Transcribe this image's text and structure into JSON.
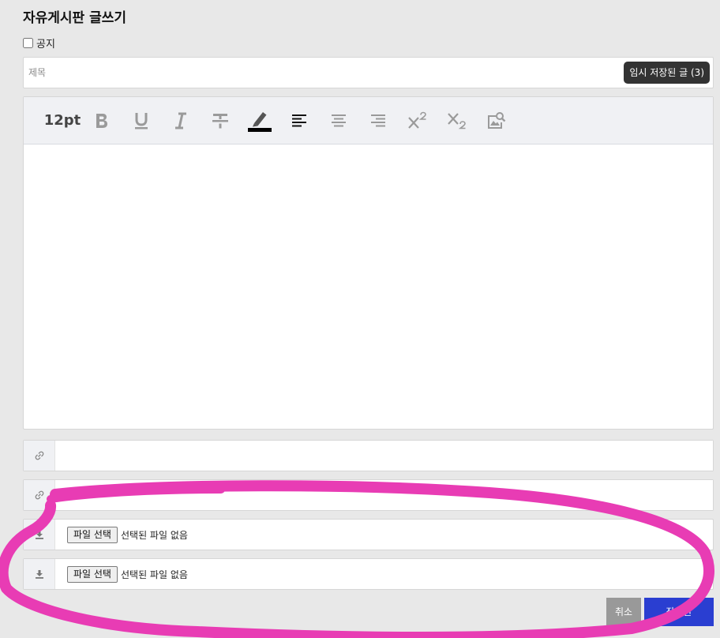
{
  "page_title": "자유게시판 글쓰기",
  "notice": {
    "label": "공지",
    "checked": false
  },
  "title_field": {
    "placeholder": "제목",
    "value": ""
  },
  "draft_button": "임시 저장된 글 (3)",
  "toolbar": {
    "font_size": "12pt",
    "icons": [
      "bold-icon",
      "underline-icon",
      "italic-icon",
      "strikethrough-icon",
      "highlight-color-icon",
      "align-left-icon",
      "align-center-icon",
      "align-right-icon",
      "superscript-icon",
      "subscript-icon",
      "image-search-icon"
    ]
  },
  "link_rows": [
    {
      "icon": "link-icon",
      "value": ""
    },
    {
      "icon": "link-icon",
      "value": ""
    }
  ],
  "file_rows": [
    {
      "icon": "download-icon",
      "button_label": "파일 선택",
      "status": "선택된 파일 없음"
    },
    {
      "icon": "download-icon",
      "button_label": "파일 선택",
      "status": "선택된 파일 없음"
    }
  ],
  "actions": {
    "cancel": "취소",
    "submit": "작성완"
  },
  "colors": {
    "accent": "#2a3ed1",
    "annotation": "#e83cb4",
    "cancel": "#999999"
  }
}
